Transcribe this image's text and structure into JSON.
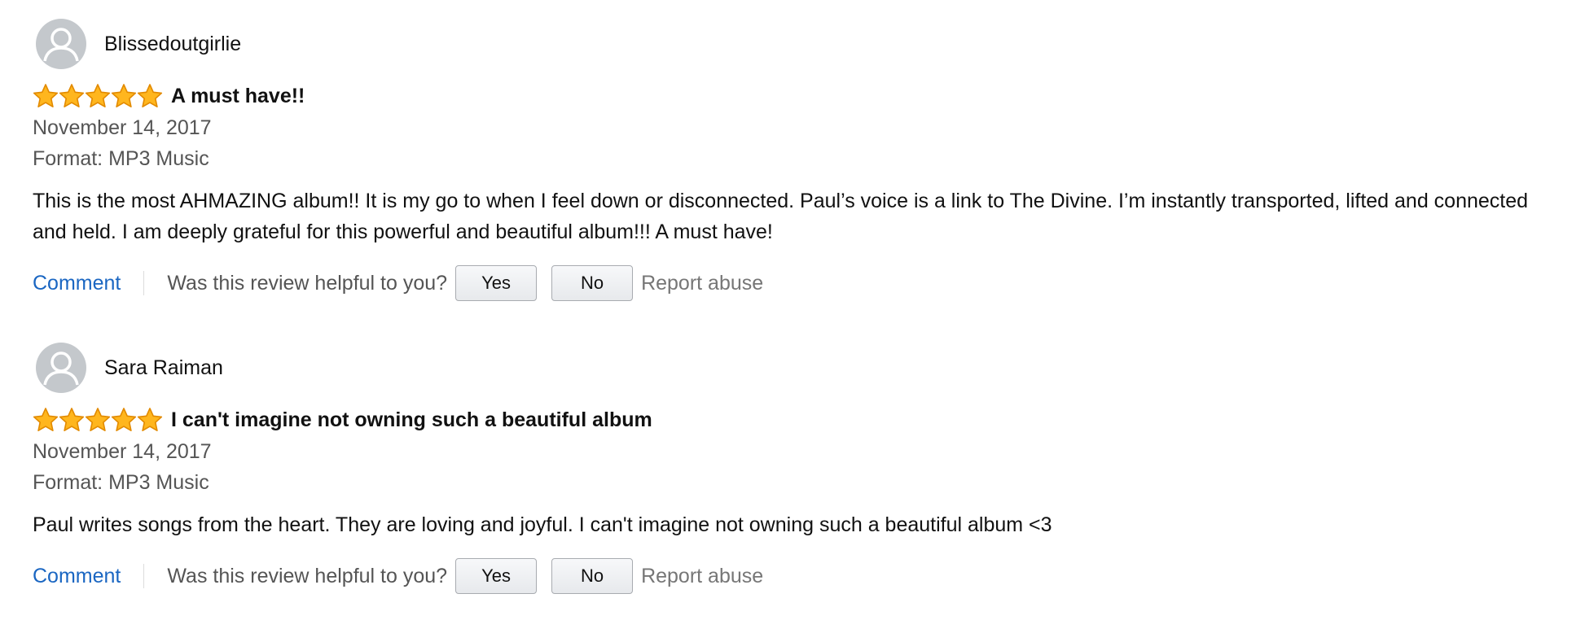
{
  "reviews": [
    {
      "reviewer": "Blissedoutgirlie",
      "rating": 5,
      "title": "A must have!!",
      "date": "November 14, 2017",
      "format": "Format: MP3 Music",
      "body": "This is the most AHMAZING album!! It is my go to when I feel down or disconnected. Paul’s voice is a link to The Divine. I’m instantly transported, lifted and connected and held. I am deeply grateful for this powerful and beautiful album!!! A must have!",
      "comment_label": "Comment",
      "helpful_prompt": "Was this review helpful to you?",
      "yes_label": "Yes",
      "no_label": "No",
      "report_label": "Report abuse"
    },
    {
      "reviewer": "Sara Raiman",
      "rating": 5,
      "title": "I can't imagine not owning such a beautiful album",
      "date": "November 14, 2017",
      "format": "Format: MP3 Music",
      "body": "Paul writes songs from the heart. They are loving and joyful. I can't imagine not owning such a beautiful album <3",
      "comment_label": "Comment",
      "helpful_prompt": "Was this review helpful to you?",
      "yes_label": "Yes",
      "no_label": "No",
      "report_label": "Report abuse"
    }
  ],
  "icons": {
    "avatar": "default-avatar-icon",
    "star": "star-icon"
  },
  "colors": {
    "link": "#1a66c2",
    "star_fill": "#ffb61e",
    "star_stroke": "#e28a00",
    "avatar_bg": "#c4c8cc",
    "secondary_text": "#555555",
    "report_text": "#767676"
  }
}
